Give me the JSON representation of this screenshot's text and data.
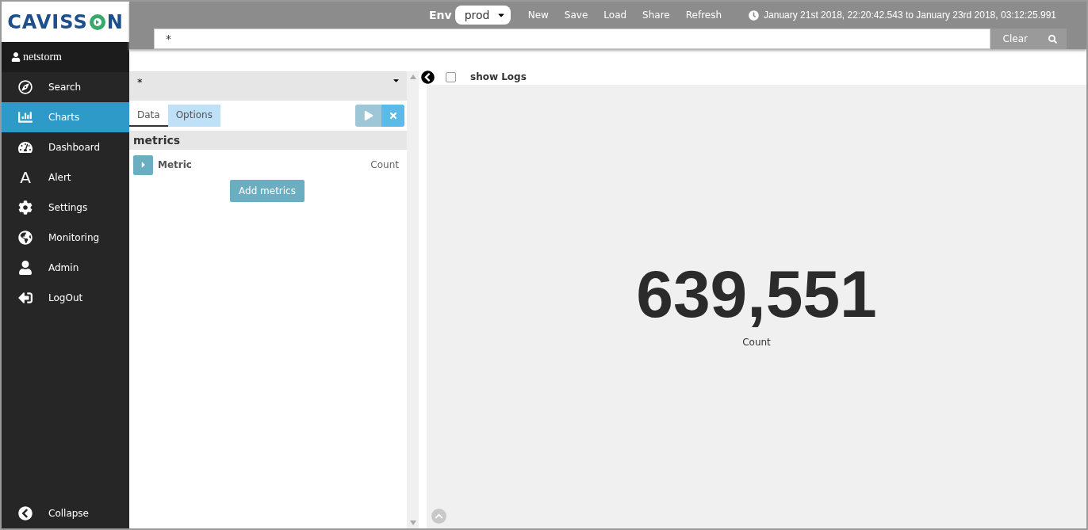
{
  "logo": "CAVISS",
  "logo_end": "N",
  "user": "netstorm",
  "sidebar": {
    "items": [
      {
        "label": "Search",
        "selected": false
      },
      {
        "label": "Charts",
        "selected": true
      },
      {
        "label": "Dashboard",
        "selected": false
      },
      {
        "label": "Alert",
        "selected": false,
        "glyph": "A"
      },
      {
        "label": "Settings",
        "selected": false
      },
      {
        "label": "Monitoring",
        "selected": false
      },
      {
        "label": "Admin",
        "selected": false
      },
      {
        "label": "LogOut",
        "selected": false
      }
    ],
    "collapse": "Collapse"
  },
  "toolbar": {
    "env_label": "Env",
    "env_value": "prod",
    "links": [
      "New",
      "Save",
      "Load",
      "Share",
      "Refresh"
    ],
    "time_range": "January 21st 2018, 22:20:42.543 to January 23rd 2018, 03:12:25.991"
  },
  "search": {
    "value": "*",
    "clear": "Clear"
  },
  "panel": {
    "query": "*",
    "tabs": [
      {
        "label": "Data",
        "selected": true
      },
      {
        "label": "Options",
        "selected": false
      }
    ],
    "section": "metrics",
    "metric": {
      "name": "Metric",
      "aggregation": "Count"
    },
    "add_button": "Add metrics"
  },
  "logs": {
    "label": "show Logs",
    "checked": false
  },
  "result": {
    "value": "639,551",
    "label": "Count"
  }
}
